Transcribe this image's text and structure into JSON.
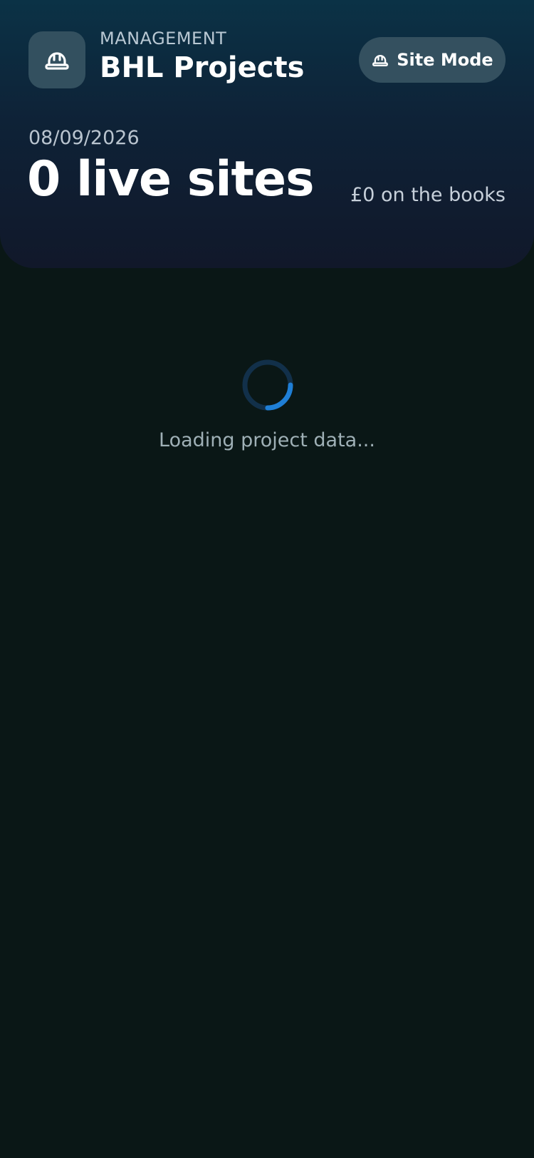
{
  "header": {
    "kicker": "MANAGEMENT",
    "title": "BHL Projects",
    "logo_icon": "hard-hat-icon",
    "mode_button": {
      "icon": "hard-hat-icon",
      "label": "Site Mode"
    },
    "date": "08/09/2026",
    "live_sites": "0 live sites",
    "books_total": "£0 on the books"
  },
  "loading": {
    "text": "Loading project data...",
    "spinner_progress": 0.25
  },
  "colors": {
    "background": "#0a1716",
    "header_top": "#0b3246",
    "header_bottom": "#11182a",
    "tile": "#33505f",
    "spinner_accent": "#1f7fd6",
    "spinner_track": "#12304a"
  }
}
